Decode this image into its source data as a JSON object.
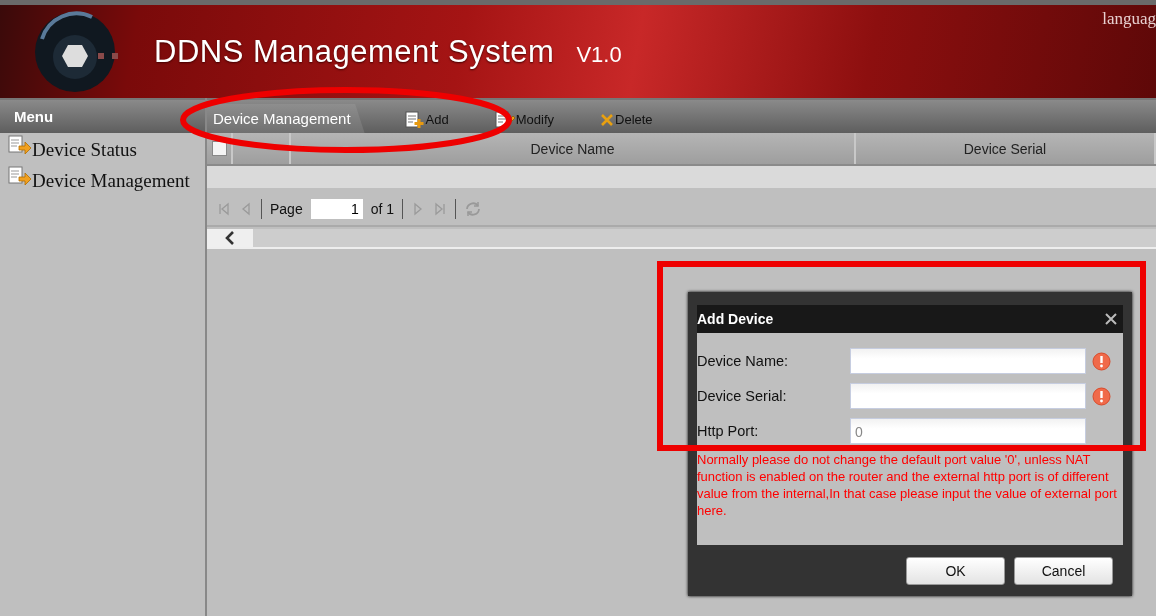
{
  "header": {
    "title": "DDNS Management System",
    "version": "V1.0",
    "language_link": "languag"
  },
  "sidebar": {
    "title": "Menu",
    "items": [
      {
        "label": "Device Status"
      },
      {
        "label": "Device Management"
      }
    ]
  },
  "toolbar": {
    "tab": {
      "label": "Device Management",
      "selected": true
    },
    "buttons": [
      {
        "label": "Add",
        "kind": "add"
      },
      {
        "label": "Modify",
        "kind": "modify"
      },
      {
        "label": "Delete",
        "kind": "delete"
      }
    ]
  },
  "table": {
    "select_all": {
      "checked": false
    },
    "columns": [
      "Device Name",
      "Device Serial"
    ]
  },
  "pager": {
    "page_label": "Page",
    "page": "1",
    "total": "of 1"
  },
  "dialog": {
    "title": "Add Device",
    "fields": [
      {
        "label": "Device Name:",
        "invalid": true
      },
      {
        "label": "Device Serial:",
        "invalid": true
      },
      {
        "label": "Http Port:",
        "value": "0",
        "invalid": false
      }
    ],
    "note": "Normally please do not change the default port value '0', unless NAT function is enabled on the router and the external http port is of different value from the internal,In that case please input the value of external port here.",
    "buttons": [
      "OK",
      "Cancel"
    ]
  },
  "annotations": [
    {
      "kind": "ellipse"
    },
    {
      "kind": "rectangle"
    }
  ]
}
